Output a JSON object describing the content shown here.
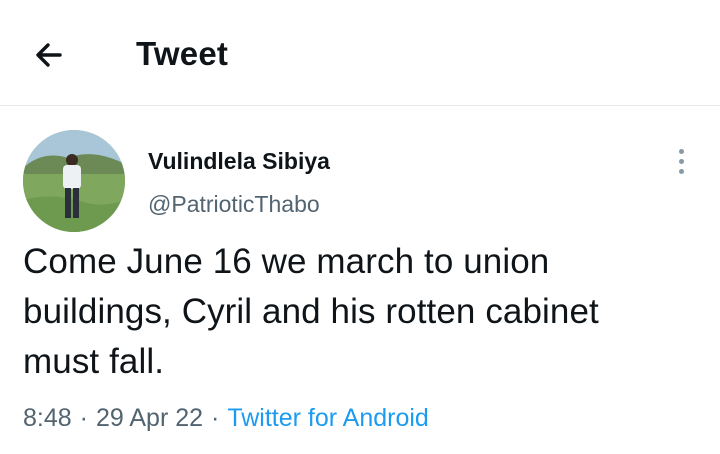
{
  "header": {
    "title": "Tweet",
    "back_icon": "arrow-left-icon"
  },
  "tweet": {
    "author": {
      "display_name": "Vulindlela Sibiya",
      "handle": "@PatrioticThabo",
      "avatar_icon": "profile-photo"
    },
    "more_icon": "more-vertical-icon",
    "text": "Come June 16 we march to union buildings, Cyril and his rotten cabinet must fall.",
    "time": "8:48",
    "date": "29 Apr 22",
    "separator": "·",
    "source": "Twitter for Android"
  },
  "colors": {
    "text": "#0f1419",
    "secondary": "#536471",
    "link": "#1d9bf0",
    "divider": "#e6e9eb"
  }
}
